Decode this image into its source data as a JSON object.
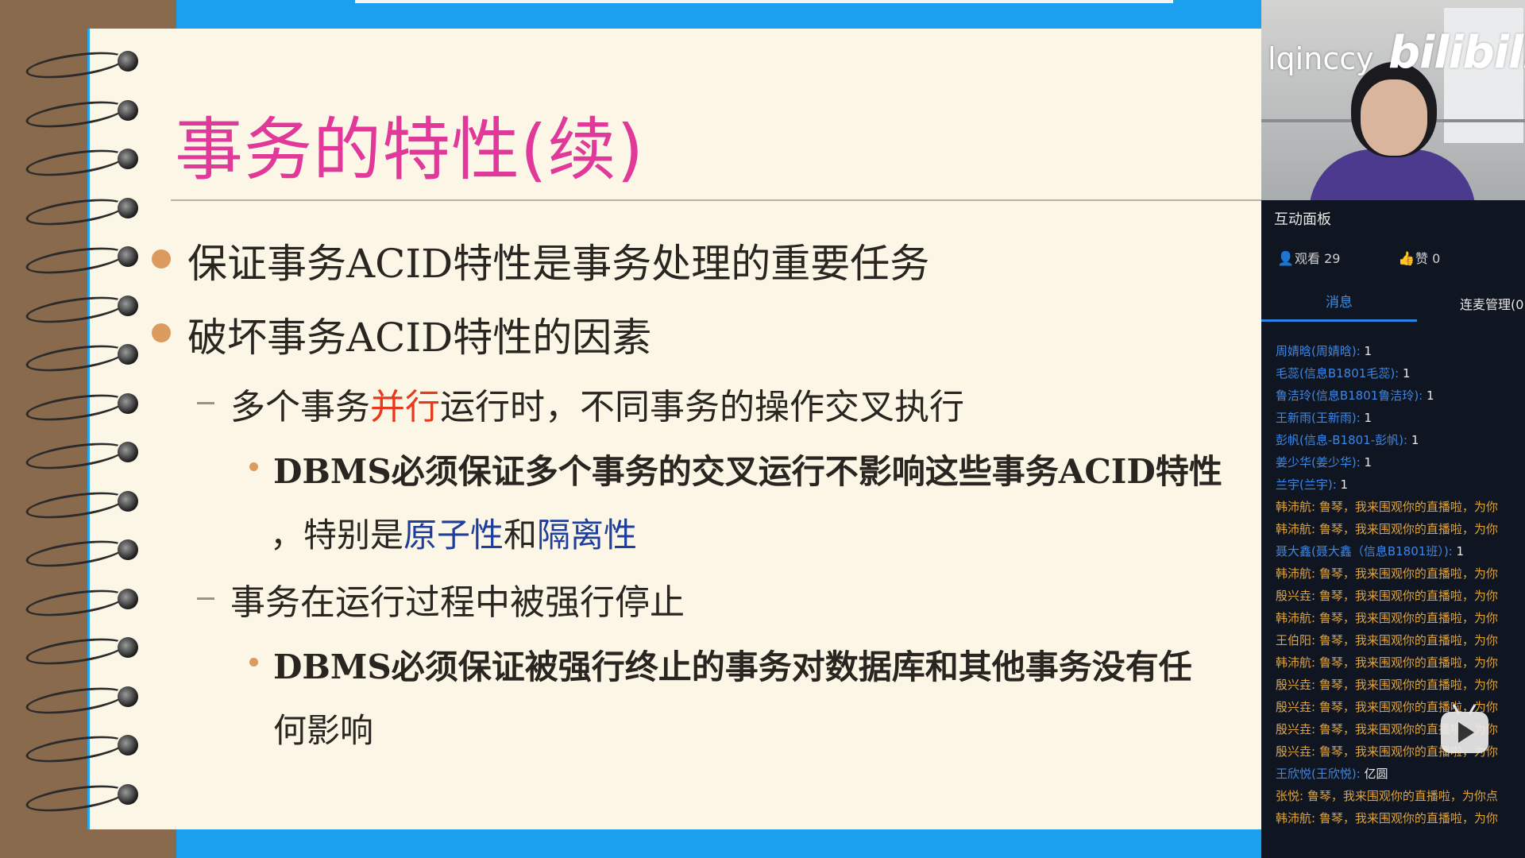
{
  "slide": {
    "title": "事务的特性(续)",
    "bullet1": "保证事务ACID特性是事务处理的重要任务",
    "bullet2": "破坏事务ACID特性的因素",
    "sub1": {
      "pre": "多个事务",
      "highlight": "并行",
      "post": "运行时，不同事务的操作交叉执行"
    },
    "sub1_point": {
      "line1": "DBMS必须保证多个事务的交叉运行不影响这些事务ACID特性",
      "line2_pre": "，特别是",
      "term1": "原子性",
      "and": "和",
      "term2": "隔离性"
    },
    "sub2": "事务在运行过程中被强行停止",
    "sub2_point": {
      "line1": "DBMS必须保证被强行终止的事务对数据库和其他事务没有任",
      "line2": "何影响"
    }
  },
  "panel": {
    "streamer": "lqinccy",
    "logo": "bilibili",
    "title": "互动面板",
    "views_label": "观看 29",
    "likes_label": "赞 0",
    "tab_messages": "消息",
    "tab_mic": "连麦管理(0",
    "chat": [
      {
        "who": "周婧晗(周婧晗):",
        "text": " 1",
        "who_color": "blue",
        "text_color": "white"
      },
      {
        "who": "毛蕊(信息B1801毛蕊):",
        "text": " 1",
        "who_color": "blue",
        "text_color": "white"
      },
      {
        "who": "鲁洁玲(信息B1801鲁洁玲):",
        "text": " 1",
        "who_color": "blue",
        "text_color": "white"
      },
      {
        "who": "王新雨(王新雨):",
        "text": " 1",
        "who_color": "blue",
        "text_color": "white"
      },
      {
        "who": "彭帆(信息-B1801-彭帆):",
        "text": " 1",
        "who_color": "blue",
        "text_color": "white"
      },
      {
        "who": "姜少华(姜少华):",
        "text": " 1",
        "who_color": "blue",
        "text_color": "white"
      },
      {
        "who": "兰宇(兰宇):",
        "text": " 1",
        "who_color": "blue",
        "text_color": "white"
      },
      {
        "who": "韩沛航:",
        "text": " 鲁琴，我来围观你的直播啦，为你",
        "who_color": "gold",
        "text_color": "gold"
      },
      {
        "who": "韩沛航:",
        "text": " 鲁琴，我来围观你的直播啦，为你",
        "who_color": "gold",
        "text_color": "gold"
      },
      {
        "who": "聂大鑫(聂大鑫（信息B1801班）):",
        "text": " 1",
        "who_color": "blue",
        "text_color": "white"
      },
      {
        "who": "韩沛航:",
        "text": " 鲁琴，我来围观你的直播啦，为你",
        "who_color": "gold",
        "text_color": "gold"
      },
      {
        "who": "殷兴垚:",
        "text": " 鲁琴，我来围观你的直播啦，为你",
        "who_color": "gold",
        "text_color": "gold"
      },
      {
        "who": "韩沛航:",
        "text": " 鲁琴，我来围观你的直播啦，为你",
        "who_color": "gold",
        "text_color": "gold"
      },
      {
        "who": "王伯阳:",
        "text": " 鲁琴，我来围观你的直播啦，为你",
        "who_color": "gold",
        "text_color": "gold"
      },
      {
        "who": "韩沛航:",
        "text": " 鲁琴，我来围观你的直播啦，为你",
        "who_color": "gold",
        "text_color": "gold"
      },
      {
        "who": "殷兴垚:",
        "text": " 鲁琴，我来围观你的直播啦，为你",
        "who_color": "gold",
        "text_color": "gold"
      },
      {
        "who": "殷兴垚:",
        "text": " 鲁琴，我来围观你的直播啦，为你",
        "who_color": "gold",
        "text_color": "gold"
      },
      {
        "who": "殷兴垚:",
        "text": " 鲁琴，我来围观你的直播啦，为你",
        "who_color": "gold",
        "text_color": "gold"
      },
      {
        "who": "殷兴垚:",
        "text": " 鲁琴，我来围观你的直播啦，为你",
        "who_color": "gold",
        "text_color": "gold"
      },
      {
        "who": "王欣悦(王欣悦):",
        "text": " 亿圆",
        "who_color": "blue",
        "text_color": "white"
      },
      {
        "who": "张悦:",
        "text": " 鲁琴，我来围观你的直播啦，为你点",
        "who_color": "gold",
        "text_color": "gold"
      },
      {
        "who": "韩沛航:",
        "text": " 鲁琴，我来围观你的直播啦，为你",
        "who_color": "gold",
        "text_color": "gold"
      }
    ]
  },
  "colors": {
    "title_pink": "#e0399a",
    "accent_blue": "#1aa0ee",
    "bullet_orange": "#dc9a5e",
    "highlight_red": "#e63a1e",
    "term_blue": "#1f3e9c",
    "chat_blue": "#3d87e6",
    "chat_gold": "#e0a33a"
  },
  "icons": [
    "viewers-icon",
    "thumbs-up-icon",
    "bilibili-play-icon"
  ]
}
